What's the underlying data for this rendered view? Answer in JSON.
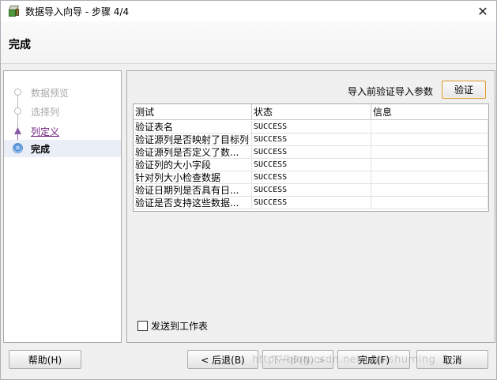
{
  "window": {
    "title": "数据导入向导 - 步骤 4/4",
    "close_glyph": "✕"
  },
  "header": {
    "title": "完成"
  },
  "steps": [
    {
      "label": "数据预览",
      "state": "disabled"
    },
    {
      "label": "选择列",
      "state": "disabled"
    },
    {
      "label": "列定义",
      "state": "link"
    },
    {
      "label": "完成",
      "state": "active"
    }
  ],
  "main": {
    "verify_label": "导入前验证导入参数",
    "verify_button": "验证",
    "columns": [
      "测试",
      "状态",
      "信息"
    ],
    "rows": [
      {
        "test": "验证表名",
        "status": "SUCCESS",
        "info": ""
      },
      {
        "test": "验证源列是否映射了目标列",
        "status": "SUCCESS",
        "info": ""
      },
      {
        "test": "验证源列是否定义了数...",
        "status": "SUCCESS",
        "info": ""
      },
      {
        "test": "验证列的大小字段",
        "status": "SUCCESS",
        "info": ""
      },
      {
        "test": "针对列大小检查数据",
        "status": "SUCCESS",
        "info": ""
      },
      {
        "test": "验证日期列是否具有日...",
        "status": "SUCCESS",
        "info": ""
      },
      {
        "test": "验证是否支持这些数据...",
        "status": "SUCCESS",
        "info": ""
      }
    ],
    "send_to_sheet_label": "发送到工作表",
    "send_to_sheet_checked": false
  },
  "footer": {
    "help": "帮助(H)",
    "back": "< 后退(B)",
    "next": "下一步(N) >",
    "finish": "完成(F)",
    "cancel": "取消"
  },
  "watermark": "http://blog.csdn.net/huaishuming"
}
